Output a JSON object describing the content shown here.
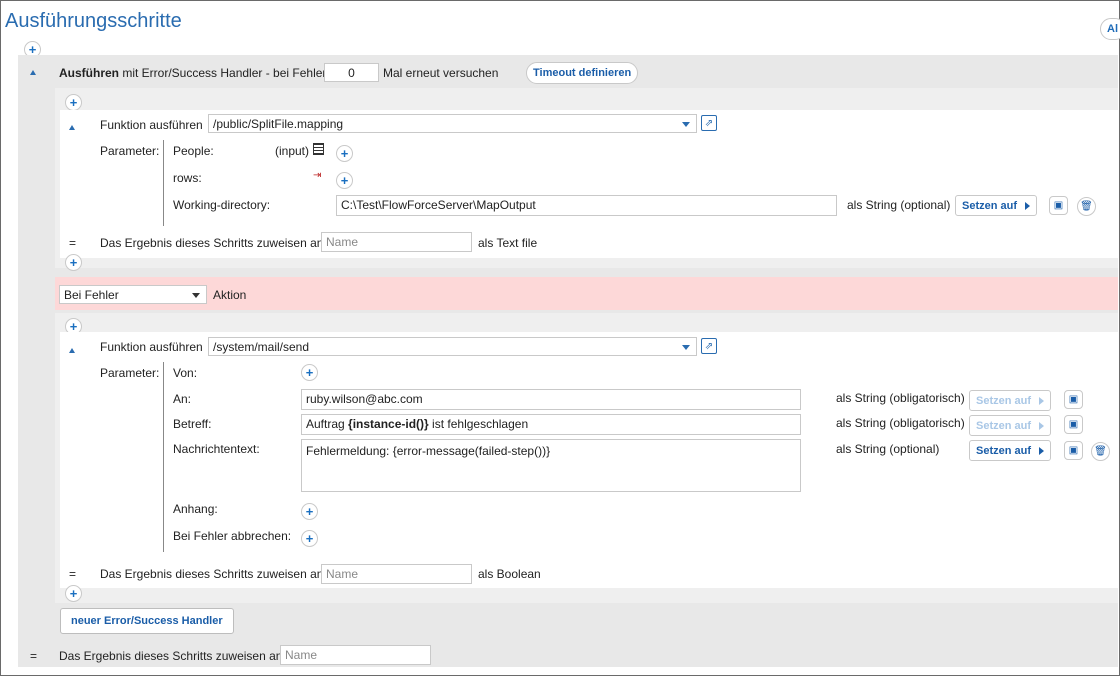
{
  "page": {
    "title": "Ausführungsschritte",
    "top_right_button": "Al"
  },
  "outer_step": {
    "label_bold": "Ausführen",
    "label_rest": "mit Error/Success Handler - bei Fehler",
    "retry_value": "0",
    "retry_suffix": "Mal erneut versuchen",
    "timeout_button": "Timeout definieren"
  },
  "step1": {
    "label": "Funktion ausführen",
    "function_path": "/public/SplitFile.mapping",
    "parameter_label": "Parameter:",
    "params": [
      {
        "name": "People:",
        "hint": "(input)"
      },
      {
        "name": "rows:"
      },
      {
        "name": "Working-directory:",
        "value": "C:\\Test\\FlowForceServer\\MapOutput",
        "type": "als String (optional)",
        "setzen": "Setzen auf"
      }
    ],
    "result_eq": "=",
    "result_label": "Das Ergebnis dieses Schritts zuweisen an",
    "result_placeholder": "Name",
    "result_type": "als Text file"
  },
  "error_handler": {
    "select_value": "Bei Fehler",
    "action_label": "Aktion"
  },
  "step2": {
    "label": "Funktion ausführen",
    "function_path": "/system/mail/send",
    "parameter_label": "Parameter:",
    "von": "Von:",
    "an": {
      "name": "An:",
      "value": "ruby.wilson@abc.com",
      "type": "als String (obligatorisch)",
      "setzen": "Setzen auf"
    },
    "betreff": {
      "name": "Betreff:",
      "value_prefix": "Auftrag ",
      "value_bold": "{instance-id()}",
      "value_suffix": " ist fehlgeschlagen",
      "type": "als String (obligatorisch)",
      "setzen": "Setzen auf"
    },
    "nachricht": {
      "name": "Nachrichtentext:",
      "value": "Fehlermeldung: {error-message(failed-step())}",
      "type": "als String (optional)",
      "setzen": "Setzen auf"
    },
    "anhang": "Anhang:",
    "abbrechen": "Bei Fehler abbrechen:",
    "result_eq": "=",
    "result_label": "Das Ergebnis dieses Schritts zuweisen an",
    "result_placeholder": "Name",
    "result_type": "als Boolean"
  },
  "new_handler_button": "neuer Error/Success Handler",
  "outer_result": {
    "eq": "=",
    "label": "Das Ergebnis dieses Schritts zuweisen an",
    "placeholder": "Name"
  }
}
